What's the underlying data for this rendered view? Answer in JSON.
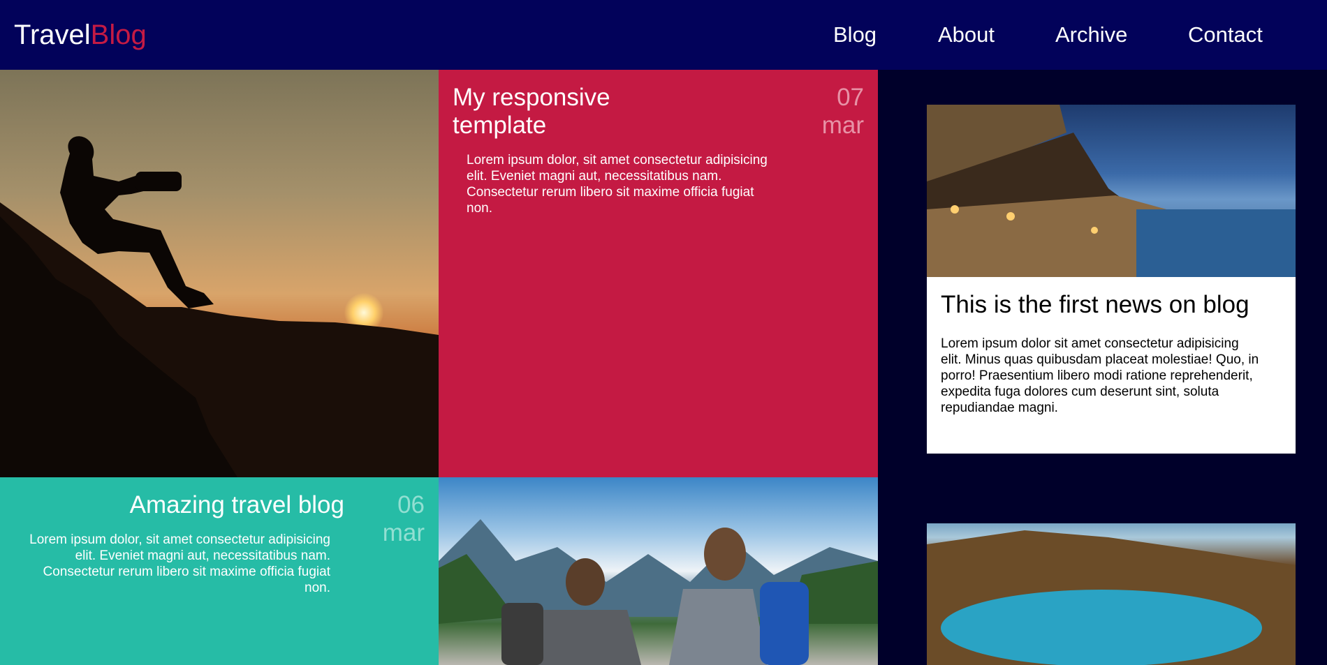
{
  "header": {
    "logo_part1": "Travel",
    "logo_part2": "Blog",
    "nav": [
      "Blog",
      "About",
      "Archive",
      "Contact"
    ]
  },
  "posts": [
    {
      "title": "My responsive template",
      "day": "07",
      "month": "mar",
      "body": "Lorem ipsum dolor, sit amet consectetur adipisicing elit. Eveniet magni aut, necessitatibus nam. Consectetur rerum libero sit maxime officia fugiat non."
    },
    {
      "title": "Amazing travel blog",
      "day": "06",
      "month": "mar",
      "body": "Lorem ipsum dolor, sit amet consectetur adipisicing elit. Eveniet magni aut, necessitatibus nam. Consectetur rerum libero sit maxime officia fugiat non."
    }
  ],
  "sidebar": {
    "news_title": "This is the first news on blog",
    "news_body": "Lorem ipsum dolor sit amet consectetur adipisicing elit. Minus quas quibusdam placeat molestiae! Quo, in porro! Praesentium libero modi ratione reprehenderit, expedita fuga dolores cum deserunt sint, soluta repudiandae magni."
  },
  "colors": {
    "header_bg": "#02025a",
    "page_bg": "#00002a",
    "accent_red": "#c41a43",
    "accent_teal": "#26bca6"
  }
}
